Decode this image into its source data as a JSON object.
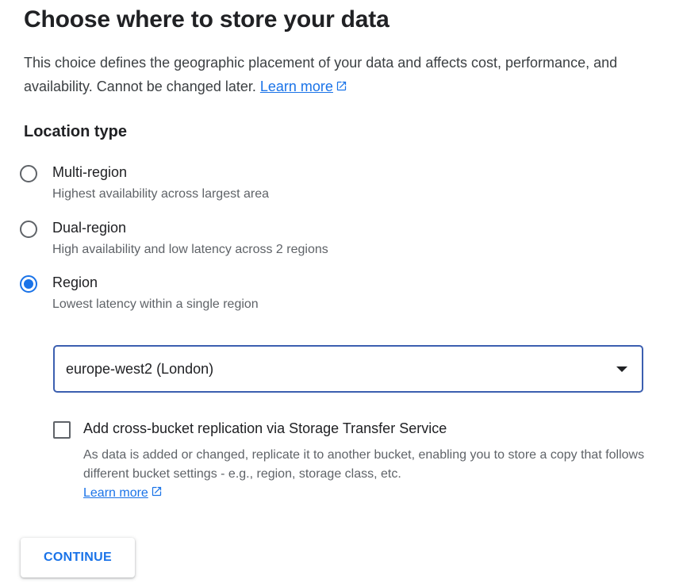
{
  "title": "Choose where to store your data",
  "intro": {
    "text": "This choice defines the geographic placement of your data and affects cost, performance, and availability. Cannot be changed later.",
    "link_label": "Learn more",
    "link_icon": "external-link-icon"
  },
  "location_type": {
    "heading": "Location type",
    "options": [
      {
        "label": "Multi-region",
        "description": "Highest availability across largest area",
        "selected": false
      },
      {
        "label": "Dual-region",
        "description": "High availability and low latency across 2 regions",
        "selected": false
      },
      {
        "label": "Region",
        "description": "Lowest latency within a single region",
        "selected": true
      }
    ]
  },
  "region_select": {
    "value": "europe-west2 (London)",
    "icon": "dropdown-arrow-icon"
  },
  "replication": {
    "checked": false,
    "label": "Add cross-bucket replication via Storage Transfer Service",
    "description": "As data is added or changed, replicate it to another bucket, enabling you to store a copy that follows different bucket settings - e.g., region, storage class, etc.",
    "link_label": "Learn more",
    "link_icon": "external-link-icon"
  },
  "continue_button": {
    "label": "CONTINUE"
  },
  "colors": {
    "accent": "#1a73e8",
    "text_primary": "#202124",
    "text_secondary": "#5f6368",
    "select_border": "#3c5fb0"
  }
}
